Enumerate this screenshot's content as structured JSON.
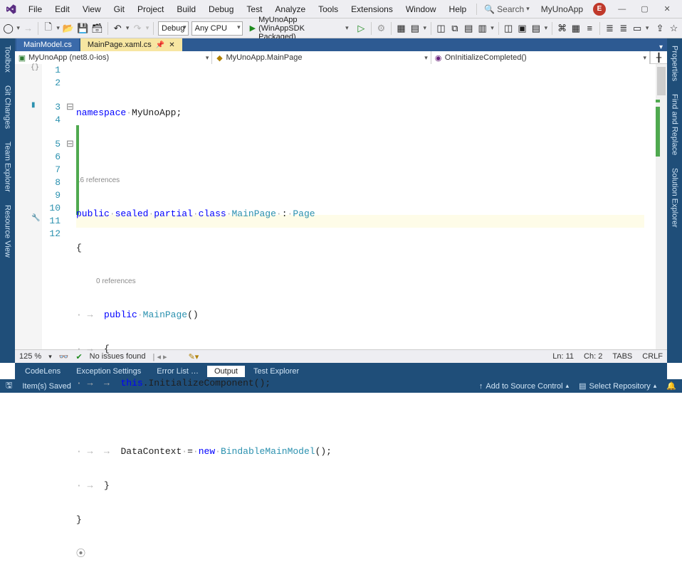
{
  "menus": [
    "File",
    "Edit",
    "View",
    "Git",
    "Project",
    "Build",
    "Debug",
    "Test",
    "Analyze",
    "Tools",
    "Extensions",
    "Window",
    "Help"
  ],
  "search_label": "Search",
  "solution": "MyUnoApp",
  "user_initial": "E",
  "toolbar": {
    "config": "Debug",
    "platform": "Any CPU",
    "start": "MyUnoApp (WinAppSDK Packaged)"
  },
  "left_tabs": [
    "Toolbox",
    "Git Changes",
    "Team Explorer",
    "Resource View"
  ],
  "right_tabs": [
    "Properties",
    "Find and Replace",
    "Solution Explorer"
  ],
  "doctabs": {
    "inactive": "MainModel.cs",
    "active": "MainPage.xaml.cs"
  },
  "nav": {
    "project": "MyUnoApp (net8.0-ios)",
    "type": "MyUnoApp.MainPage",
    "member": "OnInitializeCompleted()"
  },
  "codelens": {
    "class": "16 references",
    "ctor": "0 references"
  },
  "code": {
    "t_ns": "namespace",
    "t_app": "MyUnoApp",
    "t_public": "public",
    "t_sealed": "sealed",
    "t_partial": "partial",
    "t_class": "class",
    "t_mainpage": "MainPage",
    "t_page": "Page",
    "t_this": "this",
    "t_init": "InitializeComponent",
    "t_datacontext": "DataContext",
    "t_new": "new",
    "t_model": "BindableMainModel"
  },
  "line_numbers": [
    "1",
    "2",
    "3",
    "4",
    "5",
    "6",
    "7",
    "8",
    "9",
    "10",
    "11",
    "12"
  ],
  "edstatus": {
    "zoom": "125 %",
    "issues": "No issues found",
    "ln": "Ln: 11",
    "ch": "Ch: 2",
    "tabs": "TABS",
    "eol": "CRLF"
  },
  "bottom_tabs": [
    "CodeLens",
    "Exception Settings",
    "Error List …",
    "Output",
    "Test Explorer"
  ],
  "bottom_active": "Output",
  "status": {
    "ready": "Item(s) Saved",
    "src": "Add to Source Control",
    "repo": "Select Repository"
  }
}
